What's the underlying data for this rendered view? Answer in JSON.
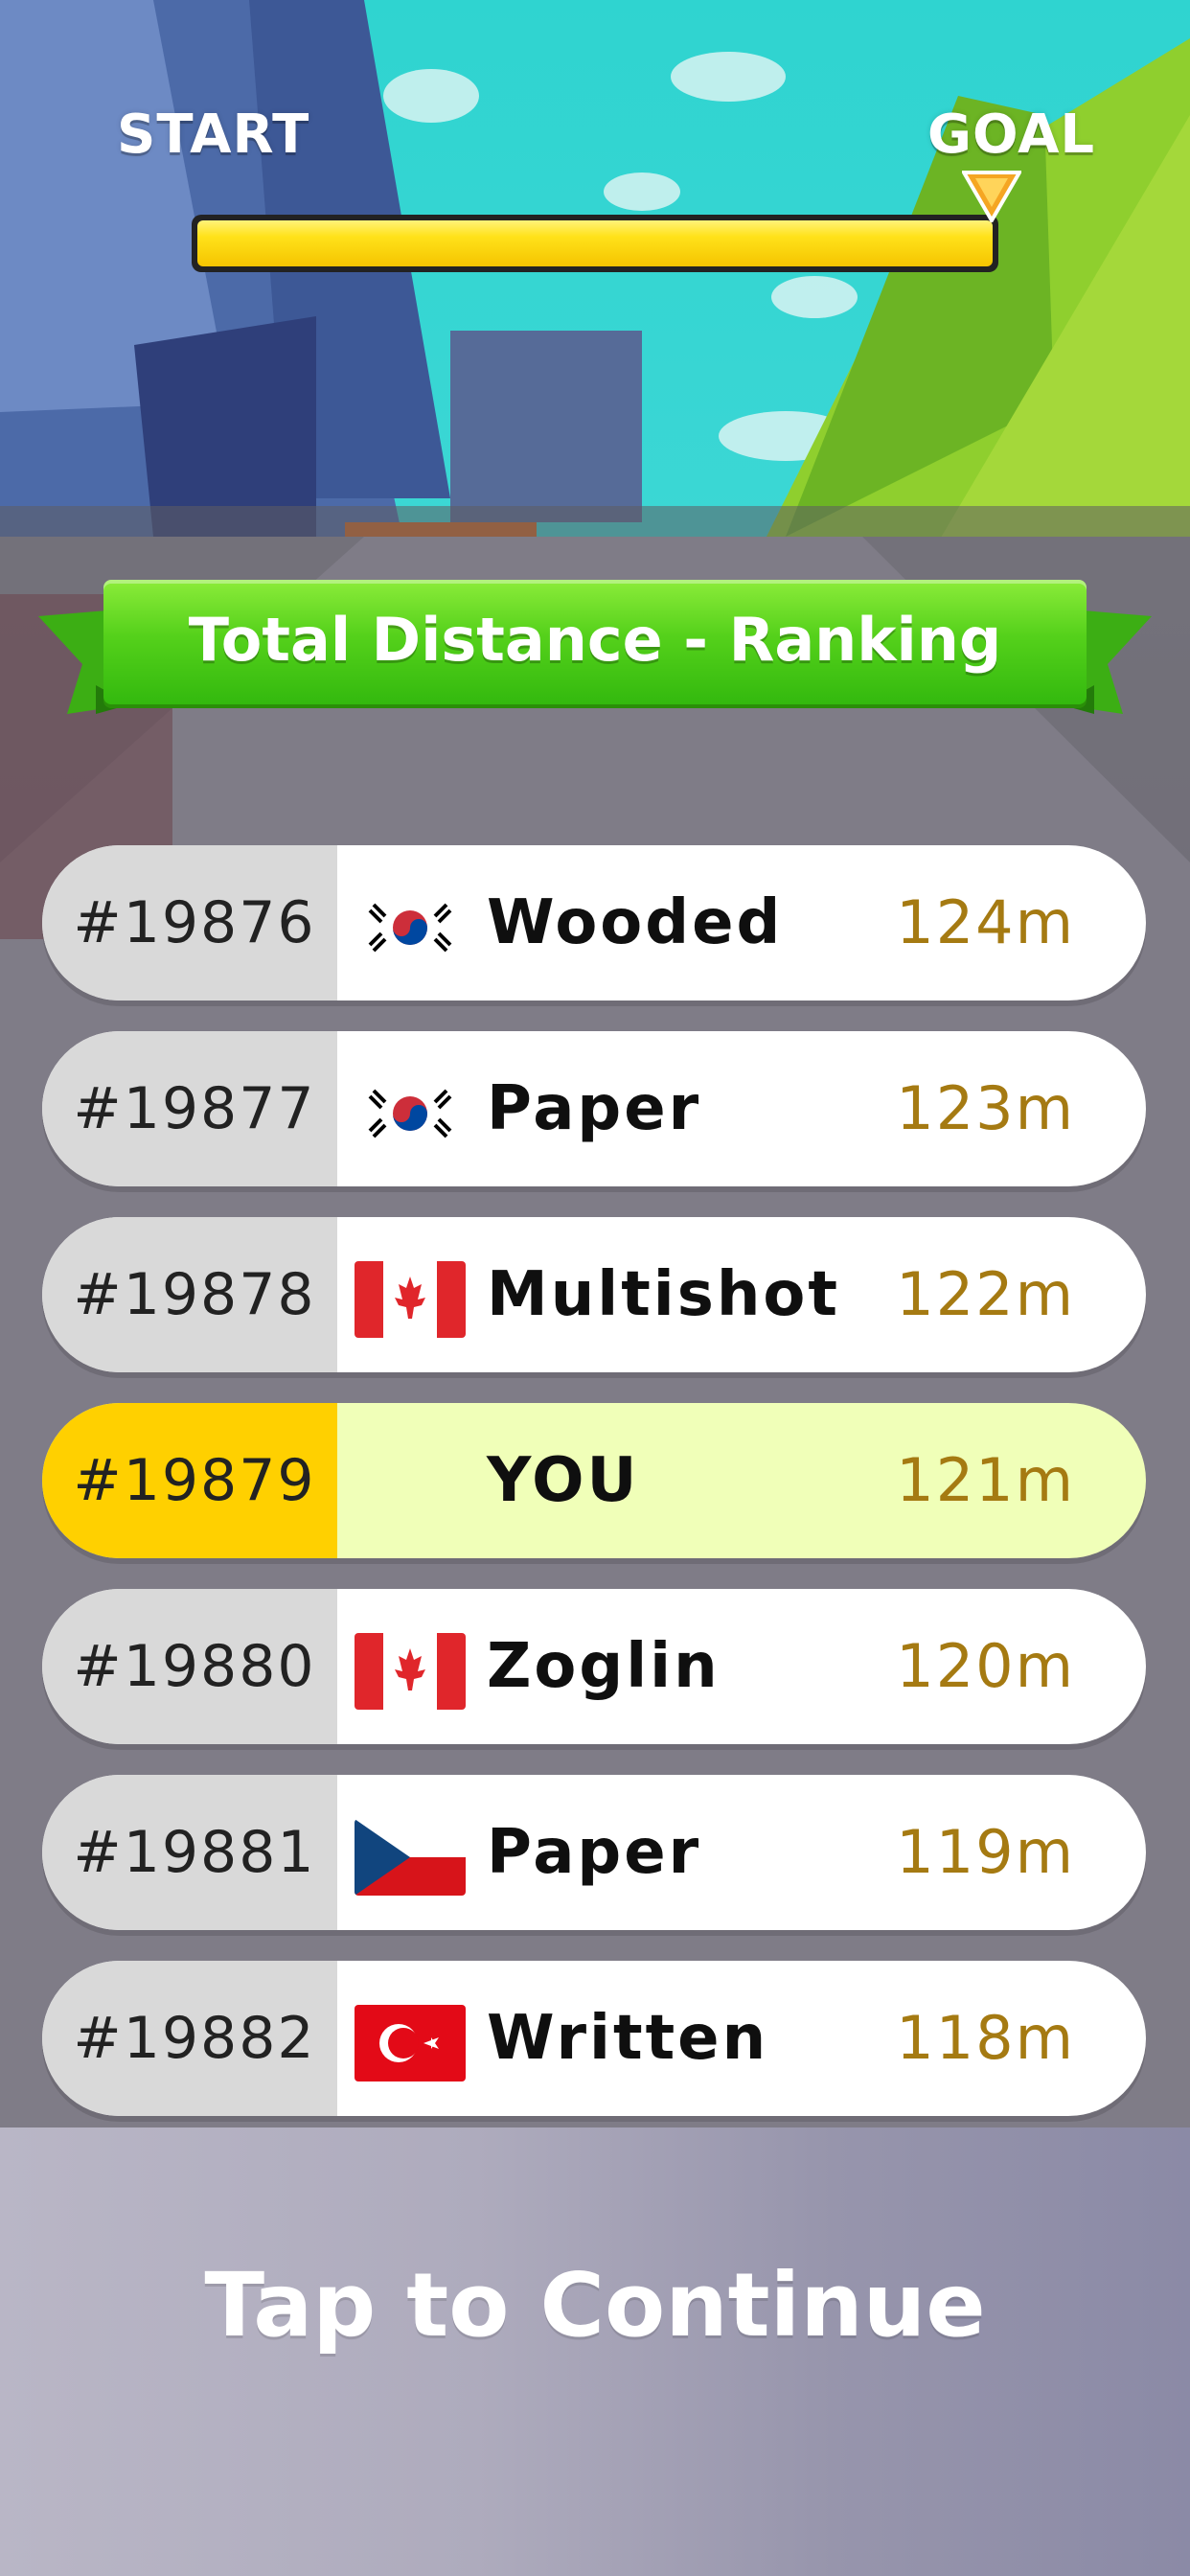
{
  "hud": {
    "start_label": "START",
    "goal_label": "GOAL",
    "progress_fraction": 1.0
  },
  "banner": {
    "title": "Total Distance - Ranking",
    "color": "#4cc61a"
  },
  "ranking": [
    {
      "rank": "#19876",
      "flag": "south-korea-flag",
      "name": "Wooded",
      "distance": "124m",
      "is_player": false
    },
    {
      "rank": "#19877",
      "flag": "south-korea-flag",
      "name": "Paper",
      "distance": "123m",
      "is_player": false
    },
    {
      "rank": "#19878",
      "flag": "canada-flag",
      "name": "Multishot",
      "distance": "122m",
      "is_player": false
    },
    {
      "rank": "#19879",
      "flag": "",
      "name": "YOU",
      "distance": "121m",
      "is_player": true
    },
    {
      "rank": "#19880",
      "flag": "canada-flag",
      "name": "Zoglin",
      "distance": "120m",
      "is_player": false
    },
    {
      "rank": "#19881",
      "flag": "czech-flag",
      "name": "Paper",
      "distance": "119m",
      "is_player": false
    },
    {
      "rank": "#19882",
      "flag": "turkey-flag",
      "name": "Written",
      "distance": "118m",
      "is_player": false
    }
  ],
  "footer": {
    "tap_label": "Tap to Continue"
  },
  "colors": {
    "player_rank_bg": "#ffd000",
    "player_row_bg": "#f0ffb8",
    "distance_text": "#a57a12",
    "progress_fill": "#ffe21a"
  }
}
